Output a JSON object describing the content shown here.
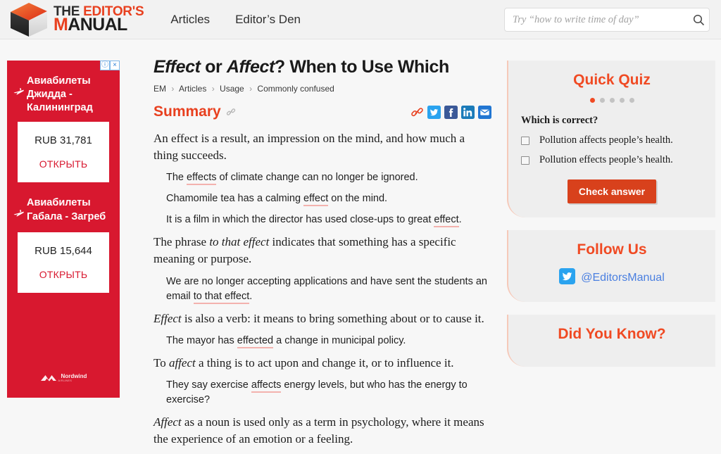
{
  "header": {
    "logo": {
      "icon": "cube-logo-icon",
      "line1_the": "THE ",
      "line1_editors": "EDITOR'S",
      "line2_m": "M",
      "line2_anual": "ANUAL"
    },
    "nav": [
      {
        "label": "Articles",
        "name": "nav-articles"
      },
      {
        "label": "Editor’s Den",
        "name": "nav-editors-den"
      }
    ],
    "search": {
      "placeholder": "Try “how to write time of day”",
      "value": "",
      "icon": "search-icon"
    }
  },
  "ad": {
    "info_label": "ⓘ",
    "close_label": "×",
    "blocks": [
      {
        "icon": "airplane-icon",
        "heading": "Авиабилеты Джидда - Калининград",
        "price": "RUB 31,781",
        "cta": "ОТКРЫТЬ"
      },
      {
        "icon": "airplane-icon",
        "heading": "Авиабилеты Габала - Загреб",
        "price": "RUB 15,644",
        "cta": "ОТКРЫТЬ"
      }
    ],
    "brand": "Nordwind",
    "brand_sub": "AIRLINES",
    "bg_color": "#d8182f"
  },
  "article": {
    "title_part1": "Effect",
    "title_or": " or ",
    "title_part2": "Affect",
    "title_rest": "? When to Use Which",
    "breadcrumbs": [
      "EM",
      "Articles",
      "Usage",
      "Commonly confused"
    ],
    "breadcrumb_separator": "›",
    "summary_heading": "Summary",
    "anchor_icon": "link-anchor-icon",
    "share_icons": [
      {
        "name": "copy-link-icon",
        "label": "link"
      },
      {
        "name": "twitter-share-icon",
        "label": "twitter"
      },
      {
        "name": "facebook-share-icon",
        "label": "facebook"
      },
      {
        "name": "linkedin-share-icon",
        "label": "linkedin"
      },
      {
        "name": "email-share-icon",
        "label": "email"
      }
    ],
    "paragraphs": [
      {
        "type": "def",
        "pre": "An effect is a result, an impression on the mind, and how much a thing succeeds.",
        "em": "",
        "post": ""
      },
      {
        "type": "ex",
        "pre": "The ",
        "em": "effects",
        "post": " of climate change can no longer be ignored."
      },
      {
        "type": "ex",
        "pre": "Chamomile tea has a calming ",
        "em": "effect",
        "post": " on the mind."
      },
      {
        "type": "ex",
        "pre": "It is a film in which the director has used close-ups to great ",
        "em": "effect",
        "post": "."
      },
      {
        "type": "def-i",
        "pre": "The phrase ",
        "em": "to that effect",
        "post": " indicates that something has a specific meaning or purpose."
      },
      {
        "type": "ex",
        "pre": "We are no longer accepting applications and have sent the students an email ",
        "em": "to that effect",
        "post": "."
      },
      {
        "type": "def-i-lead",
        "pre": "",
        "em": "Effect",
        "post": " is also a verb: it means to bring something about or to cause it."
      },
      {
        "type": "ex",
        "pre": "The mayor has ",
        "em": "effected",
        "post": " a change in municipal policy."
      },
      {
        "type": "def-i",
        "pre": "To ",
        "em": "affect",
        "post": " a thing is to act upon and change it, or to influence it."
      },
      {
        "type": "ex",
        "pre": "They say exercise ",
        "em": "affects",
        "post": " energy levels, but who has the energy to exercise?"
      },
      {
        "type": "def-i-lead",
        "pre": "",
        "em": "Affect",
        "post": " as a noun is used only as a term in psychology, where it means the experience of an emotion or a feeling."
      }
    ]
  },
  "sidebar": {
    "quiz": {
      "title": "Quick Quiz",
      "dots_total": 5,
      "dots_active_index": 0,
      "prompt": "Which is correct?",
      "options": [
        "Pollution affects people’s health.",
        "Pollution effects people’s health."
      ],
      "button_label": "Check answer"
    },
    "follow": {
      "title": "Follow Us",
      "icon": "twitter-icon",
      "handle": "@EditorsManual"
    },
    "did_you_know": {
      "title": "Did You Know?"
    },
    "accent_color": "#f04a23",
    "panel_bg": "#eeeeee"
  }
}
